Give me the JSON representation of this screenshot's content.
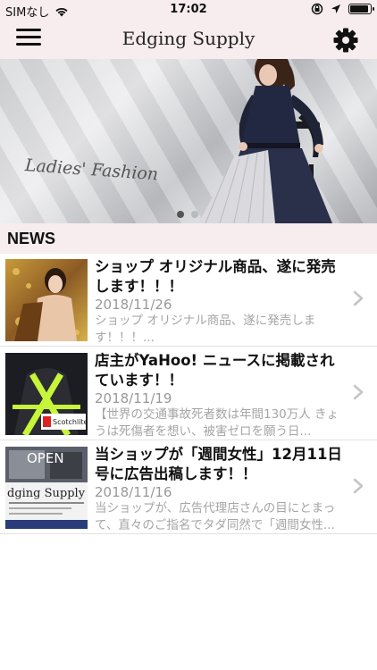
{
  "status_bar": {
    "carrier": "SIMなし",
    "time": "17:02",
    "battery_level": 0.9
  },
  "nav": {
    "title": "Edging Supply",
    "menu_icon": "hamburger-menu-icon",
    "settings_icon": "gear-icon"
  },
  "banner": {
    "text": "Ladies' Fashion",
    "slide_count": 2,
    "active_slide": 1
  },
  "news": {
    "header": "NEWS",
    "items": [
      {
        "title": "ショップ オリジナル商品、遂に発売します！！！",
        "date": "2018/11/26",
        "excerpt": "ショップ オリジナル商品、遂に発売します！！！..."
      },
      {
        "title": "店主がYaHoo! ニュースに掲載されています！！",
        "date": "2018/11/19",
        "excerpt": "【世界の交通事故死者数は年間130万人 きょうは死傷者を想い、被害ゼロを願う日..."
      },
      {
        "title": "当ショップが「週間女性」12月11日号に広告出稿します！！",
        "date": "2018/11/16",
        "excerpt": "当ショップが、広告代理店さんの目にとまって、直々のご指名でタダ同然で「週間女性..."
      }
    ]
  },
  "thumbs": {
    "item2_label": "Scotchlite",
    "item3_title": "dging Supply",
    "item3_open": "OPEN"
  }
}
